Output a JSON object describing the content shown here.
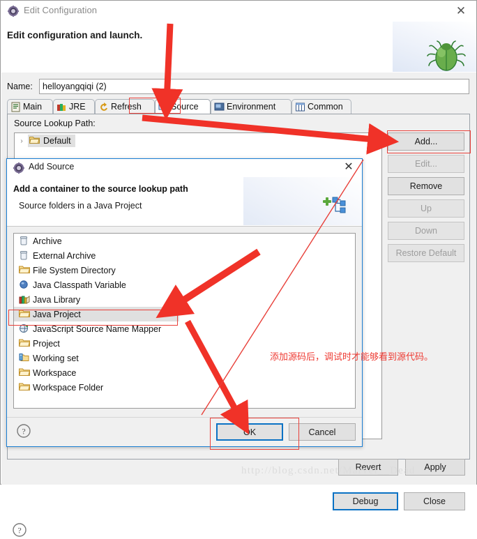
{
  "window": {
    "title": "Edit Configuration",
    "title_icon": "gear-icon",
    "close_label": "✕",
    "header_title": "Edit configuration and launch.",
    "header_icon": "green-bug-icon"
  },
  "name_field": {
    "label": "Name:",
    "value": "helloyangqiqi (2)",
    "placeholder": "Name"
  },
  "tabs": [
    {
      "label": "Main",
      "icon": "main-tab-icon",
      "active": false
    },
    {
      "label": "JRE",
      "icon": "jre-tab-icon",
      "active": false
    },
    {
      "label": "Refresh",
      "icon": "refresh-tab-icon",
      "active": false
    },
    {
      "label": "Source",
      "icon": "source-tab-icon",
      "active": true
    },
    {
      "label": "Environment",
      "icon": "environment-tab-icon",
      "active": false
    },
    {
      "label": "Common",
      "icon": "common-tab-icon",
      "active": false
    }
  ],
  "source_tab": {
    "section_label": "Source Lookup Path:",
    "tree": [
      {
        "label": "Default",
        "icon": "folder-icon",
        "expander": "›",
        "selected": true
      }
    ],
    "buttons": [
      {
        "label": "Add...",
        "enabled": true
      },
      {
        "label": "Edit...",
        "enabled": false
      },
      {
        "label": "Remove",
        "enabled": true
      },
      {
        "label": "Up",
        "enabled": false
      },
      {
        "label": "Down",
        "enabled": false
      },
      {
        "label": "Restore Default",
        "enabled": false
      }
    ]
  },
  "main_footer": {
    "help_icon": "help-icon",
    "revert_label": "Revert",
    "apply_label": "Apply",
    "debug_label": "Debug",
    "close_label": "Close"
  },
  "add_source_dialog": {
    "title": "Add Source",
    "title_icon": "gear-icon",
    "close_label": "✕",
    "heading": "Add a container to the source lookup path",
    "subheading": "Source folders in a Java Project",
    "header_icon": "add-container-icon",
    "items": [
      {
        "label": "Archive",
        "icon": "archive-icon",
        "selected": false
      },
      {
        "label": "External Archive",
        "icon": "archive-icon",
        "selected": false
      },
      {
        "label": "File System Directory",
        "icon": "folder-icon",
        "selected": false
      },
      {
        "label": "Java Classpath Variable",
        "icon": "variable-icon",
        "selected": false
      },
      {
        "label": "Java Library",
        "icon": "library-icon",
        "selected": false
      },
      {
        "label": "Java Project",
        "icon": "folder-icon",
        "selected": true
      },
      {
        "label": "JavaScript Source Name Mapper",
        "icon": "javascript-icon",
        "selected": false
      },
      {
        "label": "Project",
        "icon": "folder-icon",
        "selected": false
      },
      {
        "label": "Working set",
        "icon": "working-set-icon",
        "selected": false
      },
      {
        "label": "Workspace",
        "icon": "folder-icon",
        "selected": false
      },
      {
        "label": "Workspace Folder",
        "icon": "folder-icon",
        "selected": false
      }
    ],
    "help_icon": "help-icon",
    "ok_label": "OK",
    "cancel_label": "Cancel"
  },
  "annotations": {
    "note_text": "添加源码后，调试时才能够看到源代码。",
    "note_color": "#ee3a32",
    "highlight_color": "#e8403a",
    "arrow_color": "#f03228",
    "watermark": "http://blog.csdn.net/Marvel__Dead"
  }
}
